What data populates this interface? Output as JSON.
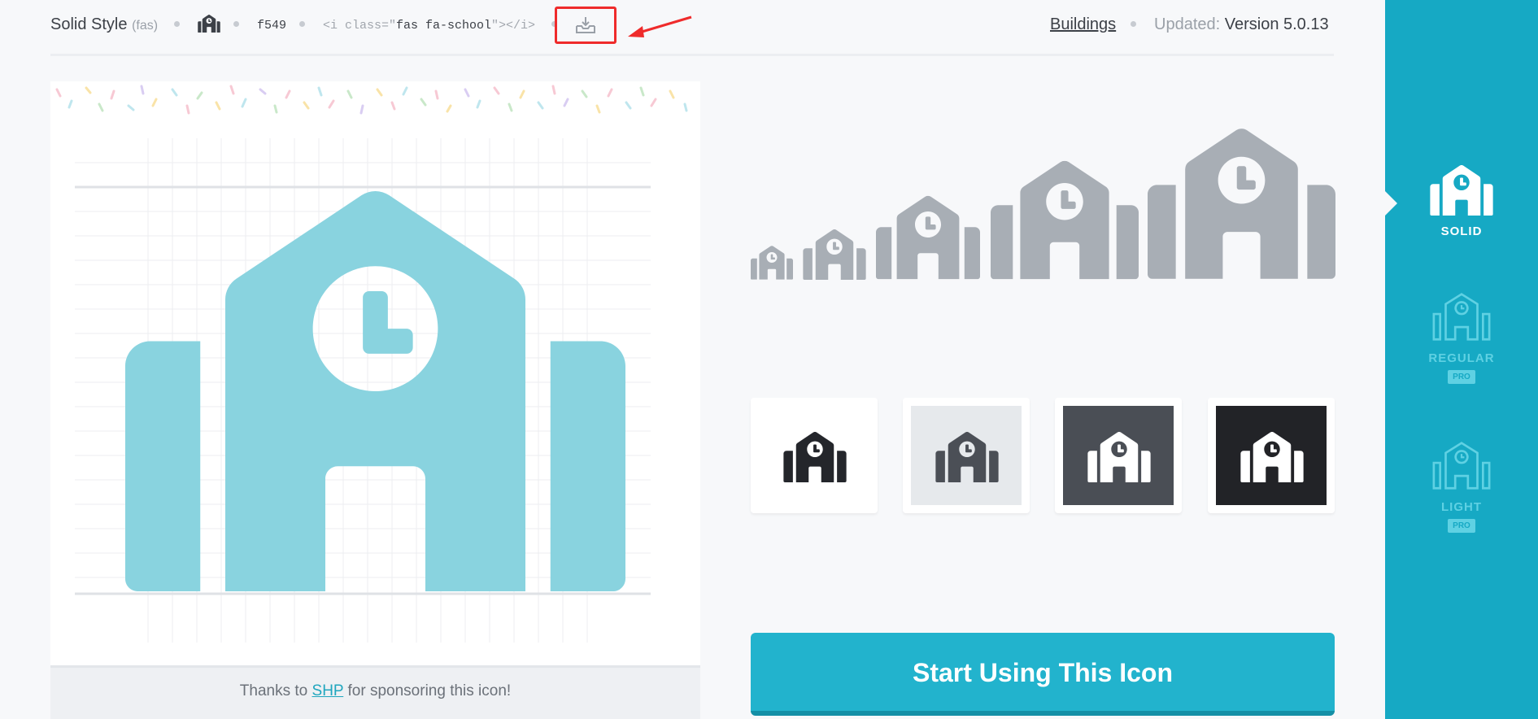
{
  "header": {
    "style_name": "Solid Style",
    "style_prefix": "(fas)",
    "unicode": "f549",
    "code_open": "<i class=\"",
    "code_class": "fas fa-school",
    "code_close": "\"></i>",
    "category": "Buildings",
    "updated_label": "Updated:",
    "version": "Version 5.0.13",
    "download_icon": "download-icon"
  },
  "sponsor": {
    "prefix": "Thanks to ",
    "link": "SHP",
    "suffix": " for sponsoring this icon!"
  },
  "cta": {
    "label": "Start Using This Icon"
  },
  "sidebar": {
    "items": [
      {
        "label": "SOLID",
        "badge": ""
      },
      {
        "label": "REGULAR",
        "badge": "PRO"
      },
      {
        "label": "LIGHT",
        "badge": "PRO"
      }
    ]
  },
  "colors": {
    "accent": "#16a9c4",
    "icon_preview": "#89d3df",
    "icon_grey": "#a8aeb5",
    "annotation_red": "#ef2b2b"
  }
}
